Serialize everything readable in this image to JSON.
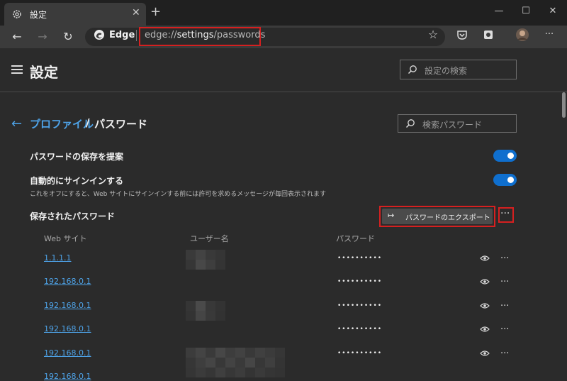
{
  "tab": {
    "title": "設定",
    "gear_icon": "gear-icon",
    "close": "✕"
  },
  "window": {
    "new_tab": "+",
    "minimize": "—",
    "maximize": "☐",
    "close": "✕"
  },
  "toolbar": {
    "back": "←",
    "forward": "→",
    "refresh": "↻",
    "site_label": "Edge",
    "url_prefix": "edge://",
    "url_highlight": "settings",
    "url_suffix": "/passwords",
    "favorite_icon": "☆",
    "more": "···"
  },
  "header": {
    "title": "設定",
    "search_placeholder": "設定の検索"
  },
  "page": {
    "breadcrumb_parent": "プロファイル",
    "breadcrumb_sep": "/",
    "breadcrumb_current": "パスワード",
    "password_search_placeholder": "検索パスワード",
    "offer_save_label": "パスワードの保存を提案",
    "autosignin_label": "自動的にサインインする",
    "autosignin_desc": "これをオフにすると、Web サイトにサインインする前には許可を求めるメッセージが毎回表示されます",
    "saved_passwords_label": "保存されたパスワード",
    "export_icon": "↦",
    "export_label": "パスワードのエクスポート",
    "more": "···"
  },
  "table": {
    "columns": [
      "Web サイト",
      "ユーザー名",
      "パスワード"
    ],
    "rows": [
      {
        "site": "1.1.1.1",
        "password": "••••••••••",
        "more": "···"
      },
      {
        "site": "192.168.0.1",
        "password": "••••••••••",
        "more": "···"
      },
      {
        "site": "192.168.0.1",
        "password": "••••••••••",
        "more": "···"
      },
      {
        "site": "192.168.0.1",
        "password": "••••••••••",
        "more": "···"
      },
      {
        "site": "192.168.0.1",
        "password": "••••••••••",
        "more": "···"
      },
      {
        "site": "192.168.0.1",
        "password": "",
        "more": ""
      }
    ]
  },
  "colors": {
    "accent": "#4ea3e8",
    "toggle_on": "#0f6fce",
    "highlight_red": "#d62020"
  }
}
